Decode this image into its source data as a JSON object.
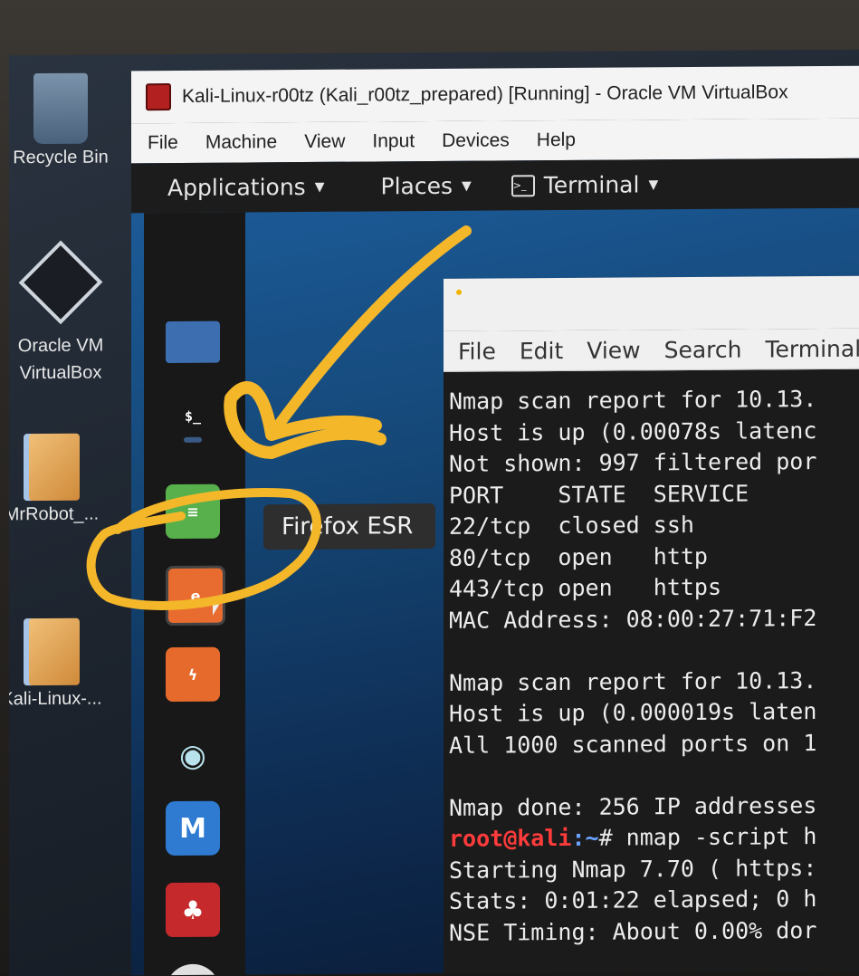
{
  "desktop": {
    "icons": [
      {
        "label": "Recycle Bin"
      },
      {
        "label": "Oracle VM\nVirtualBox"
      },
      {
        "label": "MrRobot_..."
      },
      {
        "label": "Kali-Linux-..."
      }
    ]
  },
  "vbox": {
    "title": "Kali-Linux-r00tz (Kali_r00tz_prepared) [Running] - Oracle VM VirtualBox",
    "menu": [
      "File",
      "Machine",
      "View",
      "Input",
      "Devices",
      "Help"
    ]
  },
  "kali": {
    "topbar": {
      "applications": "Applications",
      "places": "Places",
      "terminal": "Terminal"
    },
    "tooltip": "Firefox ESR",
    "dock": [
      "folder-icon",
      "terminal-icon",
      "notes-icon",
      "firefox-icon",
      "burpsuite-icon",
      "eye-icon",
      "metasploit-icon",
      "cherrytree-icon",
      "app-icon"
    ]
  },
  "terminal": {
    "menu": [
      "File",
      "Edit",
      "View",
      "Search",
      "Terminal"
    ],
    "lines": [
      "Nmap scan report for 10.13.",
      "Host is up (0.00078s latenc",
      "Not shown: 997 filtered por",
      "PORT    STATE  SERVICE",
      "22/tcp  closed ssh",
      "80/tcp  open   http",
      "443/tcp open   https",
      "MAC Address: 08:00:27:71:F2",
      "",
      "Nmap scan report for 10.13.",
      "Host is up (0.000019s laten",
      "All 1000 scanned ports on 1",
      "",
      "Nmap done: 256 IP addresses"
    ],
    "prompt_user": "root@kali",
    "prompt_path": ":~",
    "prompt_cmd": "# nmap -script h",
    "after_lines": [
      "Starting Nmap 7.70 ( https:",
      "Stats: 0:01:22 elapsed; 0 h",
      "NSE Timing: About 0.00% dor"
    ]
  },
  "annotation": {
    "color": "#f4b72a"
  }
}
